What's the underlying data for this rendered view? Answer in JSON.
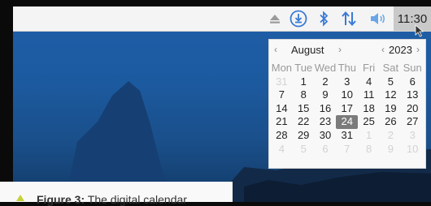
{
  "taskbar": {
    "icons": [
      "eject-icon",
      "download-icon",
      "bluetooth-icon",
      "network-updown-icon",
      "volume-icon"
    ],
    "clock": "11:30"
  },
  "calendar": {
    "month": "August",
    "year": "2023",
    "prev_month": "‹",
    "next_month": "›",
    "prev_year": "‹",
    "next_year": "›",
    "day_names": [
      "Mon",
      "Tue",
      "Wed",
      "Thu",
      "Fri",
      "Sat",
      "Sun"
    ],
    "weeks": [
      [
        "31",
        "1",
        "2",
        "3",
        "4",
        "5",
        "6"
      ],
      [
        "7",
        "8",
        "9",
        "10",
        "11",
        "12",
        "13"
      ],
      [
        "14",
        "15",
        "16",
        "17",
        "18",
        "19",
        "20"
      ],
      [
        "21",
        "22",
        "23",
        "24",
        "25",
        "26",
        "27"
      ],
      [
        "28",
        "29",
        "30",
        "31",
        "1",
        "2",
        "3"
      ],
      [
        "4",
        "5",
        "6",
        "7",
        "8",
        "9",
        "10"
      ]
    ],
    "today": "24"
  },
  "caption": {
    "label": "Figure 3:",
    "text": "The digital calendar"
  },
  "colors": {
    "accent": "#c4d23a",
    "today_bg": "#7b7b7b",
    "desktop": "#1f5fa8"
  }
}
